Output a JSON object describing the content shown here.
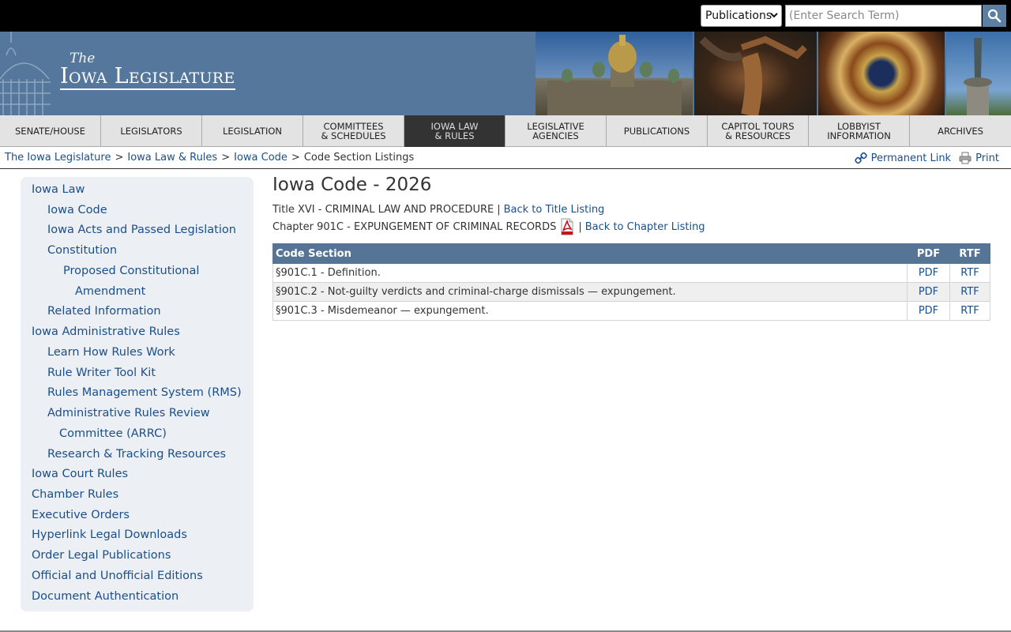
{
  "topbar": {
    "publications_select": "Publications",
    "search_placeholder": "(Enter Search Term)"
  },
  "logo": {
    "the": "The",
    "name": "Iowa Legislature"
  },
  "nav": [
    "SENATE/HOUSE",
    "LEGISLATORS",
    "LEGISLATION",
    "COMMITTEES\n& SCHEDULES",
    "IOWA LAW\n& RULES",
    "LEGISLATIVE\nAGENCIES",
    "PUBLICATIONS",
    "CAPITOL TOURS\n& RESOURCES",
    "LOBBYIST\nINFORMATION",
    "ARCHIVES"
  ],
  "breadcrumb": {
    "items": [
      "The Iowa Legislature",
      "Iowa Law & Rules",
      "Iowa Code"
    ],
    "current": "Code Section Listings",
    "sep": ">"
  },
  "tools": {
    "permanent_link": "Permanent Link",
    "print": "Print"
  },
  "sidebar": [
    "Iowa Law",
    "Iowa Code",
    "Iowa Acts and Passed Legislation",
    "Constitution",
    "Proposed Constitutional",
    "Amendment",
    "Related Information",
    "Iowa Administrative Rules",
    "Learn How Rules Work",
    "Rule Writer Tool Kit",
    "Rules Management System (RMS)",
    "Administrative Rules Review",
    "Committee (ARRC)",
    "Research & Tracking Resources",
    "Iowa Court Rules",
    "Chamber Rules",
    "Executive Orders",
    "Hyperlink Legal Downloads",
    "Order Legal Publications",
    "Official and Unofficial Editions",
    "Document Authentication"
  ],
  "main": {
    "title": "Iowa Code - 2026",
    "title_line": "Title XVI - CRIMINAL LAW AND PROCEDURE",
    "title_sep": "|",
    "back_title": "Back to Title Listing",
    "chapter_line": "Chapter 901C - EXPUNGEMENT OF CRIMINAL RECORDS",
    "chapter_sep": "|",
    "back_chapter": "Back to Chapter Listing"
  },
  "table": {
    "headers": [
      "Code Section",
      "PDF",
      "RTF"
    ],
    "rows": [
      {
        "section": "§901C.1 - Definition.",
        "pdf": "PDF",
        "rtf": "RTF"
      },
      {
        "section": "§901C.2 - Not-guilty verdicts and criminal-charge dismissals — expungement.",
        "pdf": "PDF",
        "rtf": "RTF"
      },
      {
        "section": "§901C.3 - Misdemeanor — expungement.",
        "pdf": "PDF",
        "rtf": "RTF"
      }
    ]
  }
}
